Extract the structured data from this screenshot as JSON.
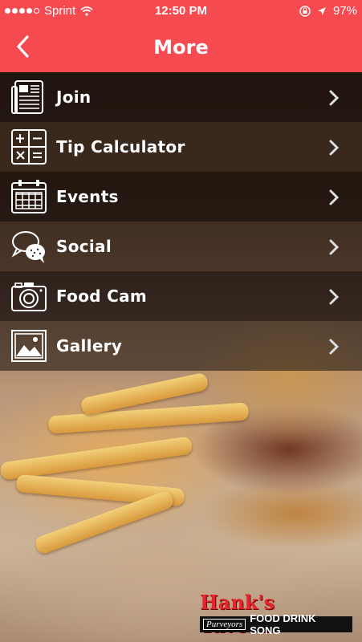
{
  "status_bar": {
    "carrier": "Sprint",
    "time": "12:50 PM",
    "battery": "97"
  },
  "header": {
    "title": "More",
    "back_icon": "chevron-left-icon"
  },
  "menu": {
    "items": [
      {
        "label": "Join",
        "icon": "newspaper-icon"
      },
      {
        "label": "Tip Calculator",
        "icon": "calculator-icon"
      },
      {
        "label": "Events",
        "icon": "calendar-icon"
      },
      {
        "label": "Social",
        "icon": "speech-bubbles-icon"
      },
      {
        "label": "Food Cam",
        "icon": "camera-icon"
      },
      {
        "label": "Gallery",
        "icon": "picture-icon"
      }
    ]
  },
  "branding": {
    "name": "Hank's Tavern",
    "purveyors": "Purveyors",
    "tagline": "FOOD DRINK SONG"
  },
  "colors": {
    "accent": "#f54a50",
    "logo_red": "#e8232b"
  }
}
